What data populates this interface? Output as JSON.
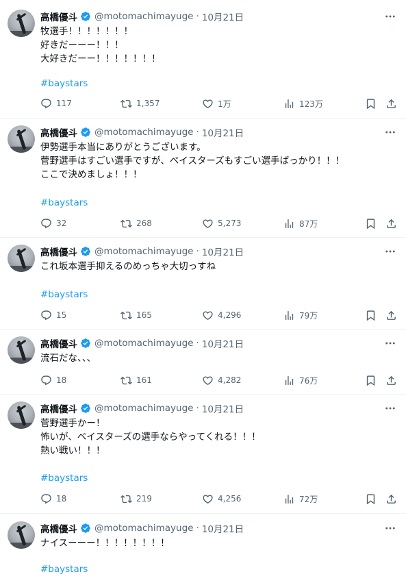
{
  "colors": {
    "accent": "#1d9bf0",
    "text": "#0f1419",
    "muted": "#536471",
    "border": "#eff3f4"
  },
  "author": {
    "name": "高橋優斗",
    "handle": "@motomachimayuge",
    "badge_icon": "verified-badge-icon",
    "avatar_icon": "avatar"
  },
  "tweets": [
    {
      "date": "10月21日",
      "lines": [
        "牧選手！！！！！！！",
        "好きだーーー！！！",
        "大好きだーー！！！！！！！"
      ],
      "hashtag": "#baystars",
      "replies": "117",
      "retweets": "1,357",
      "likes": "1万",
      "views": "123万"
    },
    {
      "date": "10月21日",
      "lines": [
        "伊勢選手本当にありがとうございます。",
        "菅野選手はすごい選手ですが、ベイスターズもすごい選手ばっかり！！！",
        "ここで決めましょ！！！"
      ],
      "hashtag": "#baystars",
      "replies": "32",
      "retweets": "268",
      "likes": "5,273",
      "views": "87万"
    },
    {
      "date": "10月21日",
      "lines": [
        "これ坂本選手抑えるのめっちゃ大切っすね"
      ],
      "hashtag": "#baystars",
      "replies": "15",
      "retweets": "165",
      "likes": "4,296",
      "views": "79万"
    },
    {
      "date": "10月21日",
      "lines": [
        "流石だな、、、"
      ],
      "hashtag": "",
      "replies": "18",
      "retweets": "161",
      "likes": "4,282",
      "views": "76万"
    },
    {
      "date": "10月21日",
      "lines": [
        "菅野選手かー！",
        "怖いが、ベイスターズの選手ならやってくれる！！！",
        "熱い戦い！！！"
      ],
      "hashtag": "#baystars",
      "replies": "18",
      "retweets": "219",
      "likes": "4,256",
      "views": "72万"
    },
    {
      "date": "10月21日",
      "lines": [
        "ナイスーーー！！！！！！！！"
      ],
      "hashtag": "#baystars",
      "replies": "",
      "retweets": "",
      "likes": "",
      "views": ""
    }
  ]
}
